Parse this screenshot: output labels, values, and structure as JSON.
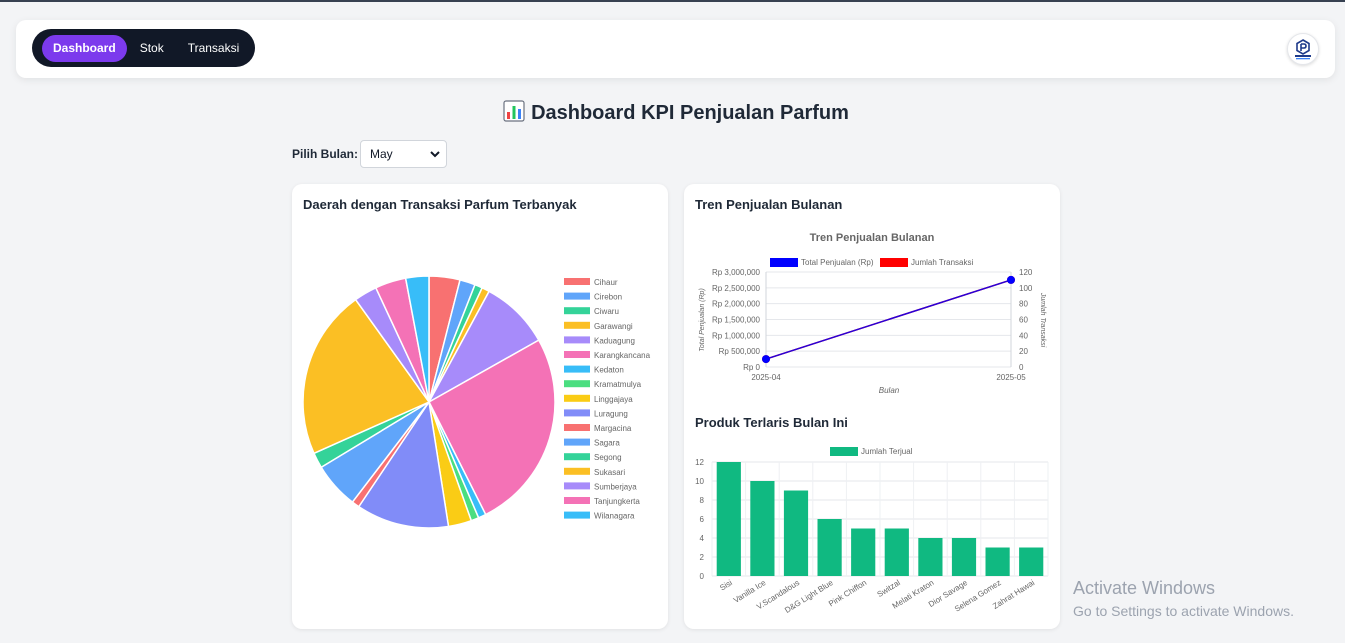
{
  "nav": {
    "items": [
      {
        "label": "Dashboard",
        "active": true
      },
      {
        "label": "Stok",
        "active": false
      },
      {
        "label": "Transaksi",
        "active": false
      }
    ]
  },
  "avatar": {
    "icon": "perfume-brand-logo",
    "label": "PARFUMKU"
  },
  "page": {
    "title": "Dashboard KPI Penjualan Parfum",
    "title_icon": "bar-chart-icon"
  },
  "filter": {
    "label": "Pilih Bulan:",
    "selected": "May"
  },
  "cards": {
    "region": {
      "title": "Daerah dengan Transaksi Parfum Terbanyak"
    },
    "trend": {
      "title": "Tren Penjualan Bulanan"
    },
    "top": {
      "title": "Produk Terlaris Bulan Ini"
    }
  },
  "chart_data": [
    {
      "type": "pie",
      "labels": [
        "Cihaur",
        "Cirebon",
        "Ciwaru",
        "Garawangi",
        "Kaduagung",
        "Karangkancana",
        "Kedaton",
        "Kramatmulya",
        "Linggajaya",
        "Luragung",
        "Margacina",
        "Sagara",
        "Segong",
        "Sukasari",
        "Sumberjaya",
        "Tanjungkerta",
        "Wilanagara"
      ],
      "colors": [
        "#f87171",
        "#60a5fa",
        "#34d399",
        "#fbbf24",
        "#a78bfa",
        "#f472b6",
        "#38bdf8",
        "#4ade80",
        "#facc15",
        "#818cf8",
        "#f87171",
        "#60a5fa",
        "#34d399",
        "#fbbf24",
        "#a78bfa",
        "#f472b6",
        "#38bdf8"
      ],
      "values": [
        4,
        2,
        1,
        1,
        9,
        26,
        1,
        1,
        3,
        12,
        1,
        6,
        2,
        22,
        3,
        4,
        3
      ],
      "legend": "right"
    },
    {
      "type": "line",
      "title": "Tren Penjualan Bulanan",
      "x": [
        "2025-04",
        "2025-05"
      ],
      "xlabel": "Bulan",
      "ylabel": "Total Penjualan (Rp)",
      "y2label": "Jumlah Transaksi",
      "ylim": [
        0,
        3000000
      ],
      "y2lim": [
        0,
        120
      ],
      "yticks": [
        "Rp 0",
        "Rp 500,000",
        "Rp 1,000,000",
        "Rp 1,500,000",
        "Rp 2,000,000",
        "Rp 2,500,000",
        "Rp 3,000,000"
      ],
      "y2ticks": [
        "0",
        "20",
        "40",
        "60",
        "80",
        "100",
        "120"
      ],
      "series": [
        {
          "name": "Total Penjualan (Rp)",
          "color": "#0000ff",
          "values": [
            250000,
            2750000
          ]
        },
        {
          "name": "Jumlah Transaksi",
          "color": "#ff0000",
          "values": [
            10,
            110
          ]
        }
      ],
      "legend": "top"
    },
    {
      "type": "bar",
      "categories": [
        "Sisi",
        "Vanilla Ice",
        "V.Scandalous",
        "D&G Light Blue",
        "Pink Chiffon",
        "Switzal",
        "Melati Kraton",
        "Dior Savage",
        "Selena Gomez",
        "Zahrat Hawai"
      ],
      "series": [
        {
          "name": "Jumlah Terjual",
          "color": "#10b981",
          "values": [
            12,
            10,
            9,
            6,
            5,
            5,
            4,
            4,
            3,
            3
          ]
        }
      ],
      "ylim": [
        0,
        12
      ],
      "yticks": [
        "0",
        "2",
        "4",
        "6",
        "8",
        "10",
        "12"
      ],
      "legend": "top"
    }
  ],
  "watermark": {
    "line1": "Activate Windows",
    "line2": "Go to Settings to activate Windows."
  }
}
